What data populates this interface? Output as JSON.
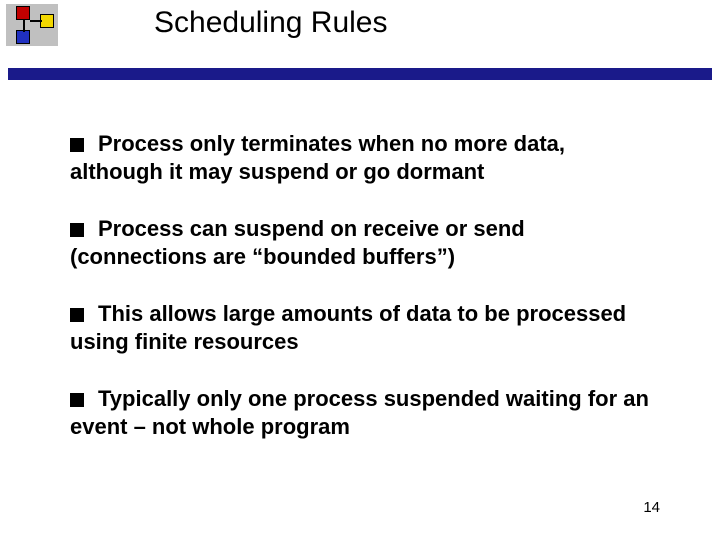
{
  "title": "Scheduling Rules",
  "bullets": [
    "Process only terminates when no more data, although it may suspend or go dormant",
    "Process can suspend on receive or send (connections are “bounded buffers”)",
    "This allows large amounts of data to be processed using finite resources",
    "Typically only one process suspended  waiting for an event – not whole program"
  ],
  "page_number": "14"
}
